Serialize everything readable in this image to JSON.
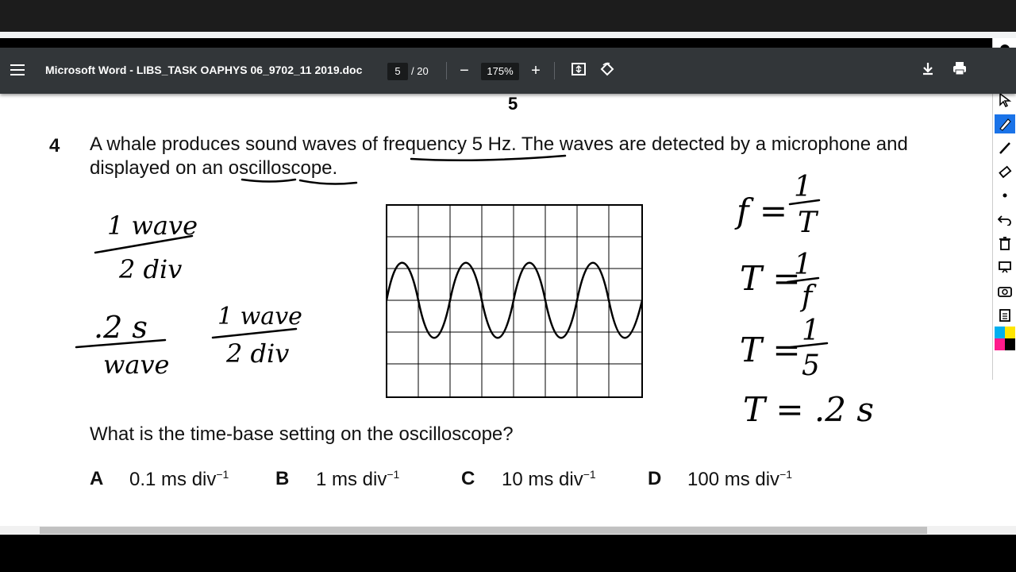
{
  "toolbar": {
    "title": "Microsoft Word - LIBS_TASK OAPHYS 06_9702_11 2019.doc",
    "page_current": "5",
    "page_total": "/ 20",
    "zoom": "175%",
    "zoom_out_label": "−",
    "zoom_in_label": "+"
  },
  "document": {
    "page_number": "5",
    "question_number": "4",
    "question_line1": "A whale produces sound waves of frequency 5 Hz. The waves are detected by a microphone and",
    "question_line2": "displayed on an oscilloscope.",
    "prompt": "What is the time-base setting on the oscilloscope?",
    "options": [
      {
        "letter": "A",
        "value": "0.1 ms div",
        "exp": "−1"
      },
      {
        "letter": "B",
        "value": "1 ms div",
        "exp": "−1"
      },
      {
        "letter": "C",
        "value": "10 ms div",
        "exp": "−1"
      },
      {
        "letter": "D",
        "value": "100 ms div",
        "exp": "−1"
      }
    ]
  },
  "annotations": {
    "left_1_top": "1 wave",
    "left_1_bottom": "2 div",
    "left_2_top": ".2 s",
    "left_2_bottom": "wave",
    "left_3_top": "1 wave",
    "left_3_bottom": "2 div",
    "eq1_lhs": "f =",
    "eq1_num": "1",
    "eq1_den": "T",
    "eq2_lhs": "T =",
    "eq2_num": "1",
    "eq2_den": "f",
    "eq3_lhs": "T =",
    "eq3_num": "1",
    "eq3_den": "5",
    "eq4": "T = .2 s"
  },
  "side_tools": [
    "eye-icon",
    "cursor-icon",
    "highlighter-icon",
    "pen-icon",
    "eraser-icon",
    "dot-icon",
    "undo-icon",
    "trash-icon",
    "screen-icon",
    "camera-icon",
    "clipboard-icon",
    "palette-icon"
  ],
  "colors": {
    "toolbar": "#323639",
    "ink": "#000000",
    "page": "#ffffff"
  }
}
